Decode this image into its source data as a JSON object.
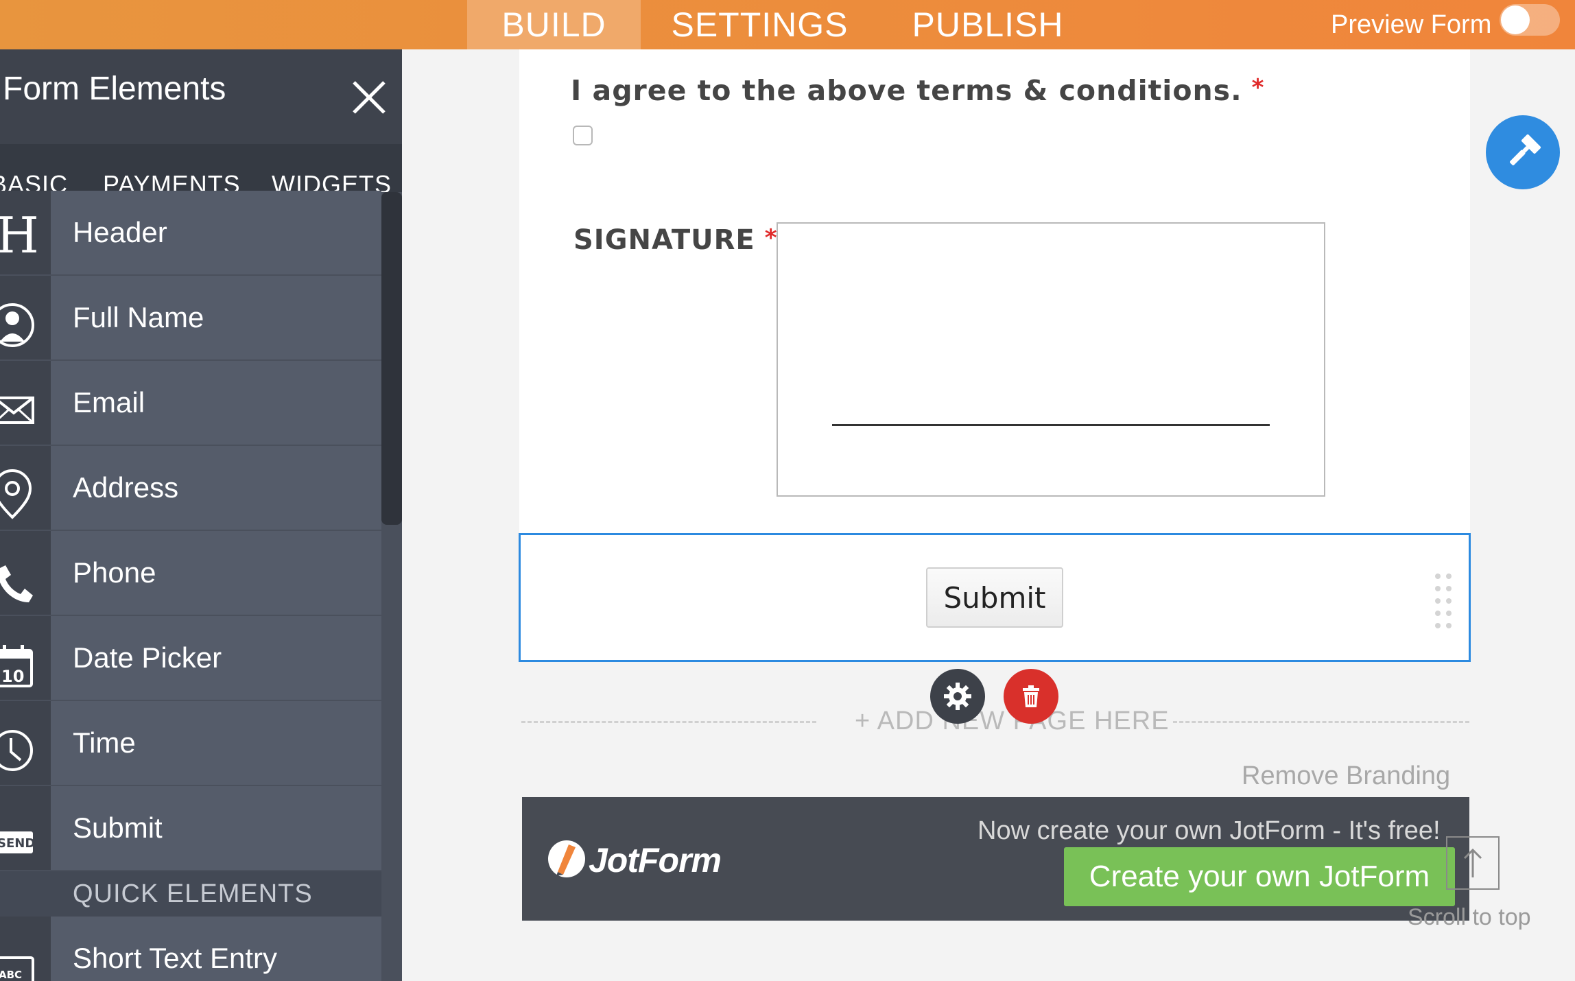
{
  "topbar": {
    "tabs": [
      {
        "label": "BUILD",
        "active": true
      },
      {
        "label": "SETTINGS",
        "active": false
      },
      {
        "label": "PUBLISH",
        "active": false
      }
    ],
    "preview_label": "Preview Form",
    "preview_enabled": false,
    "accent_color": "#f0853b"
  },
  "sidebar": {
    "title": "Form Elements",
    "tabs": [
      "BASIC",
      "PAYMENTS",
      "WIDGETS"
    ],
    "items": [
      {
        "label": "Header",
        "icon": "header-icon"
      },
      {
        "label": "Full Name",
        "icon": "user-icon"
      },
      {
        "label": "Email",
        "icon": "envelope-icon"
      },
      {
        "label": "Address",
        "icon": "location-pin-icon"
      },
      {
        "label": "Phone",
        "icon": "phone-icon"
      },
      {
        "label": "Date Picker",
        "icon": "calendar-icon",
        "icon_text": "10"
      },
      {
        "label": "Time",
        "icon": "clock-icon"
      },
      {
        "label": "Submit",
        "icon": "send-icon",
        "icon_text": "SEND"
      }
    ],
    "quick_heading": "QUICK ELEMENTS",
    "quick_items": [
      {
        "label": "Short Text Entry",
        "icon": "text-box-icon",
        "icon_text": "ABC"
      }
    ]
  },
  "form": {
    "terms_label": "I agree to the above terms & conditions.",
    "required_mark": "*",
    "signature_label": "SIGNATURE",
    "submit_label": "Submit",
    "add_page_label": "+ ADD NEW PAGE HERE",
    "remove_branding": "Remove Branding",
    "selection_color": "#2c8ae0"
  },
  "banner": {
    "logo_text": "JotForm",
    "tagline": "Now create your own JotForm - It's free!",
    "cta_label": "Create your own JotForm",
    "cta_color": "#79c157"
  },
  "scroll_top": {
    "label": "Scroll to top"
  }
}
